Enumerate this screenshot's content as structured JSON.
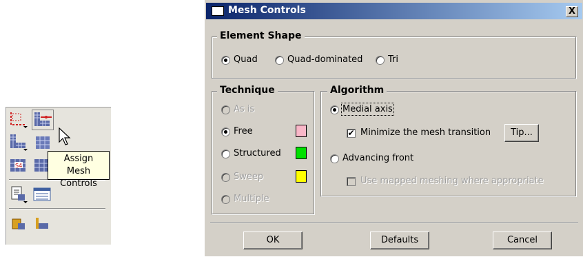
{
  "tooltip": {
    "line1": "Assign",
    "line2": "Mesh Controls"
  },
  "toolbox": {
    "icons": [
      "seed-edges-icon",
      "mesh-controls-icon",
      "element-type-icon",
      "assign-element-type-icon",
      "s4-element-icon",
      "mesh-part-icon",
      "query-icon",
      "mesh-module-icon",
      "verify-mesh-icon",
      "edit-mesh-icon"
    ]
  },
  "dialog": {
    "title": "Mesh Controls",
    "close_label": "X",
    "element_shape": {
      "legend": "Element Shape",
      "options": [
        "Quad",
        "Quad-dominated",
        "Tri"
      ],
      "selected": "Quad"
    },
    "technique": {
      "legend": "Technique",
      "options": [
        {
          "label": "As is",
          "enabled": false,
          "selected": false,
          "swatch": ""
        },
        {
          "label": "Free",
          "enabled": true,
          "selected": true,
          "swatch": "#f9b7c8"
        },
        {
          "label": "Structured",
          "enabled": true,
          "selected": false,
          "swatch": "#00e000"
        },
        {
          "label": "Sweep",
          "enabled": false,
          "selected": false,
          "swatch": "#ffff00"
        },
        {
          "label": "Multiple",
          "enabled": false,
          "selected": false,
          "swatch": ""
        }
      ]
    },
    "algorithm": {
      "legend": "Algorithm",
      "medial_axis": "Medial axis",
      "minimize_transition": "Minimize the mesh transition",
      "minimize_checked": true,
      "tip_label": "Tip...",
      "advancing_front": "Advancing front",
      "use_mapped": "Use mapped meshing where appropriate",
      "use_mapped_checked": false,
      "selected": "Medial axis"
    },
    "buttons": {
      "ok": "OK",
      "defaults": "Defaults",
      "cancel": "Cancel"
    }
  }
}
